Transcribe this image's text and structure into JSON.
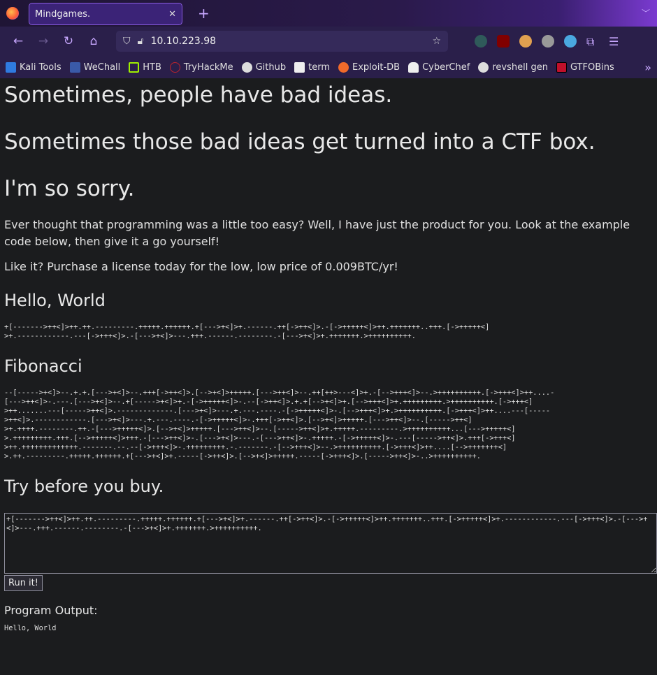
{
  "browser": {
    "tab_title": "Mindgames.",
    "url": "10.10.223.98",
    "bookmarks": [
      {
        "label": "Kali Tools",
        "color": "#2f7be0"
      },
      {
        "label": "WeChall",
        "color": "#3a5aa8"
      },
      {
        "label": "HTB",
        "color": "#9fef00"
      },
      {
        "label": "TryHackMe",
        "color": "#c0242c"
      },
      {
        "label": "Github",
        "color": "#dddddd"
      },
      {
        "label": "term",
        "color": "#eeeeee"
      },
      {
        "label": "Exploit-DB",
        "color": "#f06a2a"
      },
      {
        "label": "CyberChef",
        "color": "#eeeeee"
      },
      {
        "label": "revshell gen",
        "color": "#dddddd"
      },
      {
        "label": "GTFOBins",
        "color": "#c0102a"
      }
    ]
  },
  "page": {
    "h1": [
      "Sometimes, people have bad ideas.",
      "Sometimes those bad ideas get turned into a CTF box.",
      "I'm so sorry."
    ],
    "intro": "Ever thought that programming was a little too easy? Well, I have just the product for you. Look at the example code below, then give it a go yourself!",
    "price": "Like it? Purchase a license today for the low, low price of 0.009BTC/yr!",
    "hello_title": "Hello, World",
    "hello_code": "+[------->++<]>++.++.---------.+++++.++++++.+[--->+<]>+.------.++[->++<]>.-[->+++++<]>++.+++++++..+++.[->+++++<]\n>+.------------.---[->+++<]>.-[--->+<]>---.+++.------.--------.-[--->+<]>+.+++++++.>++++++++++.",
    "fib_title": "Fibonacci",
    "fib_code": "--[----->+<]>--.+.+.[--->+<]>--.+++[->++<]>.[-->+<]>+++++.[--->++<]>--.++[++>---<]>+.-[-->+++<]>--.>++++++++++.[->+++<]>++....-\n[--->++<]>-.---.[--->+<]>--.+[----->+<]>+.-[->+++++<]>-.--[->++<]>.+.+[-->+<]>+.[-->+++<]>+.+++++++++.>++++++++++.[->+++<]\n>++.......---[----->++<]>.-------------.[--->+<]>---.+.---.----.-[->+++++<]>-.[-->+++<]>+.>++++++++++.[->+++<]>++....---[-----\n>++<]>.------------.[--->+<]>---.+.---.----.-[->+++++<]>-.+++[->++<]>.[-->+<]>+++++.[--->++<]>--.[----->++<]\n>+.++++.--------.++.-[--->+++++<]>.[-->+<]>+++++.[--->++<]>--.[----->++<]>+.+++++.---------.>++++++++++...[--->+++++<]\n>.+++++++++.+++.[-->+++++<]>+++.-[--->++<]>-.[--->+<]>---.-[--->++<]>-.+++++.-[->+++++<]>-.---[----->++<]>.+++[->+++<]\n>++.+++++++++++++.-------.--.--[->+++<]>-.+++++++++.-.-------.-[-->+++<]>--.>++++++++++.[->+++<]>++....[-->+++++++<]\n>.++.---------.+++++.++++++.+[--->+<]>+.-----[->++<]>.[-->+<]>+++++.-----[->+++<]>.[----->++<]>-..>++++++++++.",
    "try_title": "Try before you buy.",
    "input_code": "+[------->++<]>++.++.---------.+++++.++++++.+[--->+<]>+.------.++[->++<]>.-[->+++++<]>++.+++++++..+++.[->+++++<]>+.------------.---[->+++<]>.-[--->+<]>---.+++.------.--------.-[--->+<]>+.+++++++.>++++++++++.",
    "run_label": "Run it!",
    "output_label": "Program Output:",
    "output": "Hello, World"
  }
}
